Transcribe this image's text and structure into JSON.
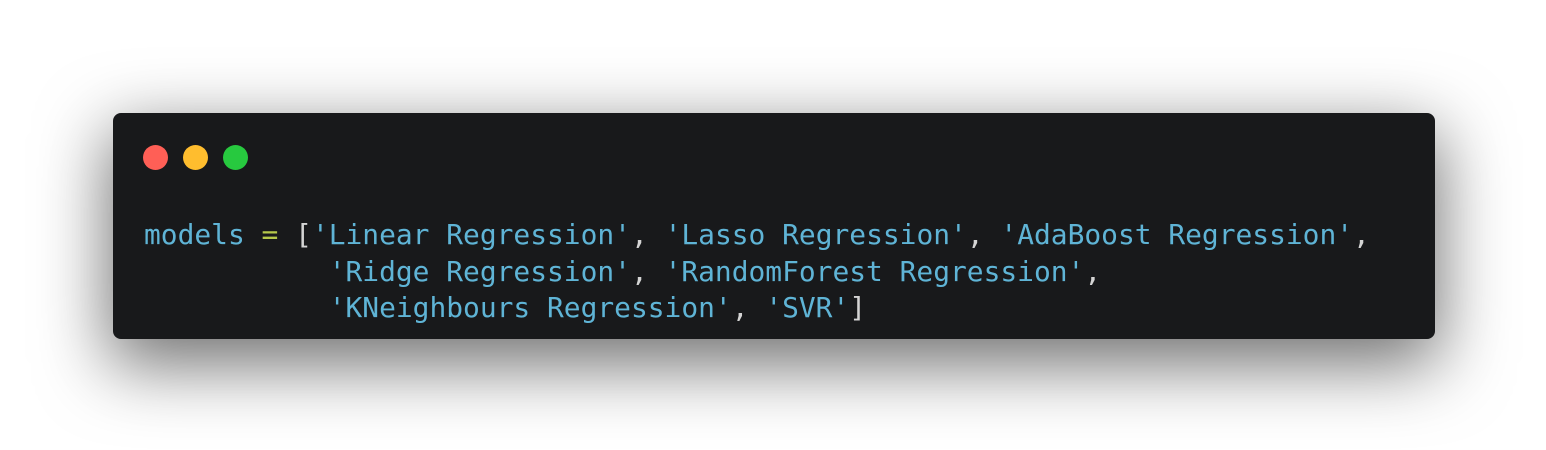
{
  "window": {
    "controls": [
      "close",
      "minimize",
      "maximize"
    ]
  },
  "code": {
    "variable": "models",
    "operator": "=",
    "open_bracket": "[",
    "close_bracket": "]",
    "separator": ", ",
    "strings": [
      "'Linear Regression'",
      "'Lasso Regression'",
      "'AdaBoost Regression'",
      "'Ridge Regression'",
      "'RandomForest Regression'",
      "'KNeighbours Regression'",
      "'SVR'"
    ],
    "trailing_comma": ",",
    "indent": "           "
  },
  "colors": {
    "window_bg": "#18191b",
    "close": "#ff5f56",
    "minimize": "#ffbd2e",
    "maximize": "#27c93f",
    "identifier": "#5fb4d6",
    "string": "#5fb4d6",
    "operator": "#b5c84a",
    "punctuation": "#d4d4d4"
  }
}
